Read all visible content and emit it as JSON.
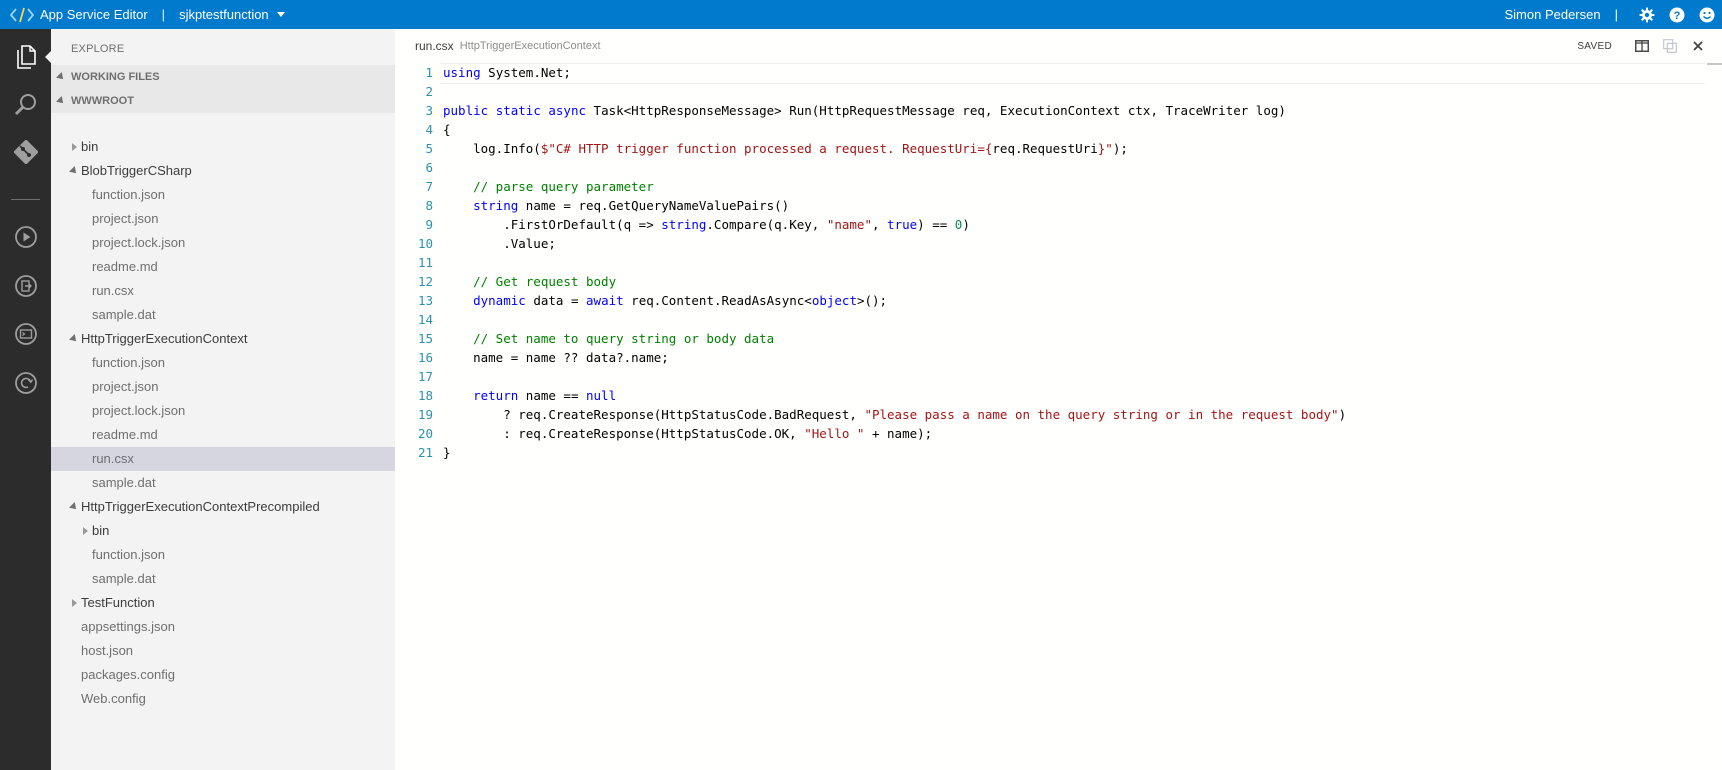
{
  "titlebar": {
    "app_name": "App Service Editor",
    "separator": "|",
    "site_name": "sjkptestfunction",
    "user_name": "Simon Pedersen",
    "user_separator": "|",
    "icons": [
      "gear-icon",
      "help-icon",
      "smiley-feedback-icon"
    ]
  },
  "activitybar": {
    "items": [
      "files-icon",
      "search-icon",
      "git-icon",
      "run-icon",
      "output-icon",
      "console-icon",
      "publish-icon"
    ]
  },
  "sidebar": {
    "explore_title": "EXPLORE",
    "working_files_label": "WORKING FILES",
    "root_label": "WWWROOT",
    "tree": [
      {
        "label": "bin",
        "type": "folder",
        "state": "collapsed",
        "depth": 1
      },
      {
        "label": "BlobTriggerCSharp",
        "type": "folder",
        "state": "expanded",
        "depth": 1
      },
      {
        "label": "function.json",
        "type": "file",
        "depth": 2
      },
      {
        "label": "project.json",
        "type": "file",
        "depth": 2
      },
      {
        "label": "project.lock.json",
        "type": "file",
        "depth": 2
      },
      {
        "label": "readme.md",
        "type": "file",
        "depth": 2
      },
      {
        "label": "run.csx",
        "type": "file",
        "depth": 2
      },
      {
        "label": "sample.dat",
        "type": "file",
        "depth": 2
      },
      {
        "label": "HttpTriggerExecutionContext",
        "type": "folder",
        "state": "expanded",
        "depth": 1
      },
      {
        "label": "function.json",
        "type": "file",
        "depth": 2
      },
      {
        "label": "project.json",
        "type": "file",
        "depth": 2
      },
      {
        "label": "project.lock.json",
        "type": "file",
        "depth": 2
      },
      {
        "label": "readme.md",
        "type": "file",
        "depth": 2
      },
      {
        "label": "run.csx",
        "type": "file",
        "depth": 2,
        "selected": true
      },
      {
        "label": "sample.dat",
        "type": "file",
        "depth": 2
      },
      {
        "label": "HttpTriggerExecutionContextPrecompiled",
        "type": "folder",
        "state": "expanded",
        "depth": 1
      },
      {
        "label": "bin",
        "type": "folder",
        "state": "collapsed",
        "depth": 2
      },
      {
        "label": "function.json",
        "type": "file",
        "depth": 2
      },
      {
        "label": "sample.dat",
        "type": "file",
        "depth": 2
      },
      {
        "label": "TestFunction",
        "type": "folder",
        "state": "collapsed",
        "depth": 1
      },
      {
        "label": "appsettings.json",
        "type": "file",
        "depth": 1
      },
      {
        "label": "host.json",
        "type": "file",
        "depth": 1
      },
      {
        "label": "packages.config",
        "type": "file",
        "depth": 1
      },
      {
        "label": "Web.config",
        "type": "file",
        "depth": 1
      }
    ]
  },
  "editor": {
    "filename": "run.csx",
    "path": "HttpTriggerExecutionContext",
    "status": "SAVED",
    "action_icons": [
      "split-editor-icon",
      "open-changes-icon",
      "close-icon"
    ],
    "current_line": 1,
    "lines": [
      [
        [
          "k",
          "using"
        ],
        [
          "t",
          " System.Net;"
        ]
      ],
      [],
      [
        [
          "k",
          "public"
        ],
        [
          "t",
          " "
        ],
        [
          "k",
          "static"
        ],
        [
          "t",
          " "
        ],
        [
          "k",
          "async"
        ],
        [
          "t",
          " Task<HttpResponseMessage> Run(HttpRequestMessage req, ExecutionContext ctx, TraceWriter log)"
        ]
      ],
      [
        [
          "t",
          "{"
        ]
      ],
      [
        [
          "t",
          "    log.Info("
        ],
        [
          "s",
          "$\"C# HTTP trigger function processed a request. RequestUri={"
        ],
        [
          "t",
          "req.RequestUri"
        ],
        [
          "s",
          "}\""
        ],
        [
          "t",
          ");"
        ]
      ],
      [],
      [
        [
          "c",
          "    // parse query parameter"
        ]
      ],
      [
        [
          "t",
          "    "
        ],
        [
          "k",
          "string"
        ],
        [
          "t",
          " name = req.GetQueryNameValuePairs()"
        ]
      ],
      [
        [
          "t",
          "        .FirstOrDefault(q => "
        ],
        [
          "k",
          "string"
        ],
        [
          "t",
          ".Compare(q.Key, "
        ],
        [
          "s",
          "\"name\""
        ],
        [
          "t",
          ", "
        ],
        [
          "k",
          "true"
        ],
        [
          "t",
          ") == "
        ],
        [
          "n",
          "0"
        ],
        [
          "t",
          ")"
        ]
      ],
      [
        [
          "t",
          "        .Value;"
        ]
      ],
      [],
      [
        [
          "c",
          "    // Get request body"
        ]
      ],
      [
        [
          "t",
          "    "
        ],
        [
          "k",
          "dynamic"
        ],
        [
          "t",
          " data = "
        ],
        [
          "k",
          "await"
        ],
        [
          "t",
          " req.Content.ReadAsAsync<"
        ],
        [
          "k",
          "object"
        ],
        [
          "t",
          ">();"
        ]
      ],
      [],
      [
        [
          "c",
          "    // Set name to query string or body data"
        ]
      ],
      [
        [
          "t",
          "    name = name ?? data?.name;"
        ]
      ],
      [],
      [
        [
          "t",
          "    "
        ],
        [
          "k",
          "return"
        ],
        [
          "t",
          " name == "
        ],
        [
          "k",
          "null"
        ]
      ],
      [
        [
          "t",
          "        ? req.CreateResponse(HttpStatusCode.BadRequest, "
        ],
        [
          "s",
          "\"Please pass a name on the query string or in the request body\""
        ],
        [
          "t",
          ")"
        ]
      ],
      [
        [
          "t",
          "        : req.CreateResponse(HttpStatusCode.OK, "
        ],
        [
          "s",
          "\"Hello \""
        ],
        [
          "t",
          " + name);"
        ]
      ],
      [
        [
          "t",
          "}"
        ]
      ]
    ]
  },
  "colors": {
    "titlebar": "#007acc",
    "activitybar": "#2c2c2c",
    "sidebar": "#f3f3f3",
    "selected_row": "#d5d6df",
    "keyword": "#0000ff",
    "string": "#a31515",
    "comment": "#008000",
    "line_number": "#2b91af"
  }
}
